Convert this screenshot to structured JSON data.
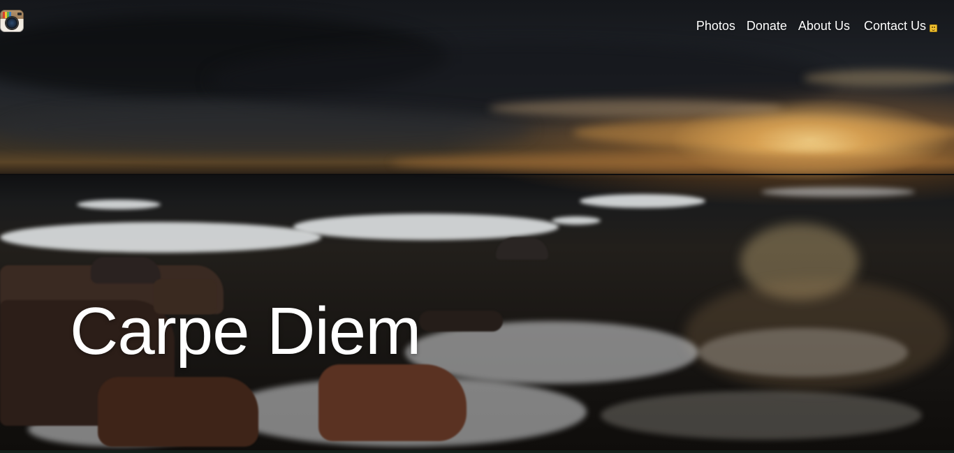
{
  "header": {
    "logo_icon": "instagram-camera-icon"
  },
  "nav": {
    "items": [
      {
        "label": "Photos"
      },
      {
        "label": "Donate"
      },
      {
        "label": "About Us"
      },
      {
        "label": "Contact Us",
        "icon": "smiley-emoji-icon"
      }
    ]
  },
  "hero": {
    "headline": "Carpe Diem",
    "background_description_icon": "sunset-sea-photo"
  },
  "colors": {
    "text": "#ffffff",
    "sky_dark": "#1c1f24",
    "sun_glow": "#ffd98a"
  }
}
